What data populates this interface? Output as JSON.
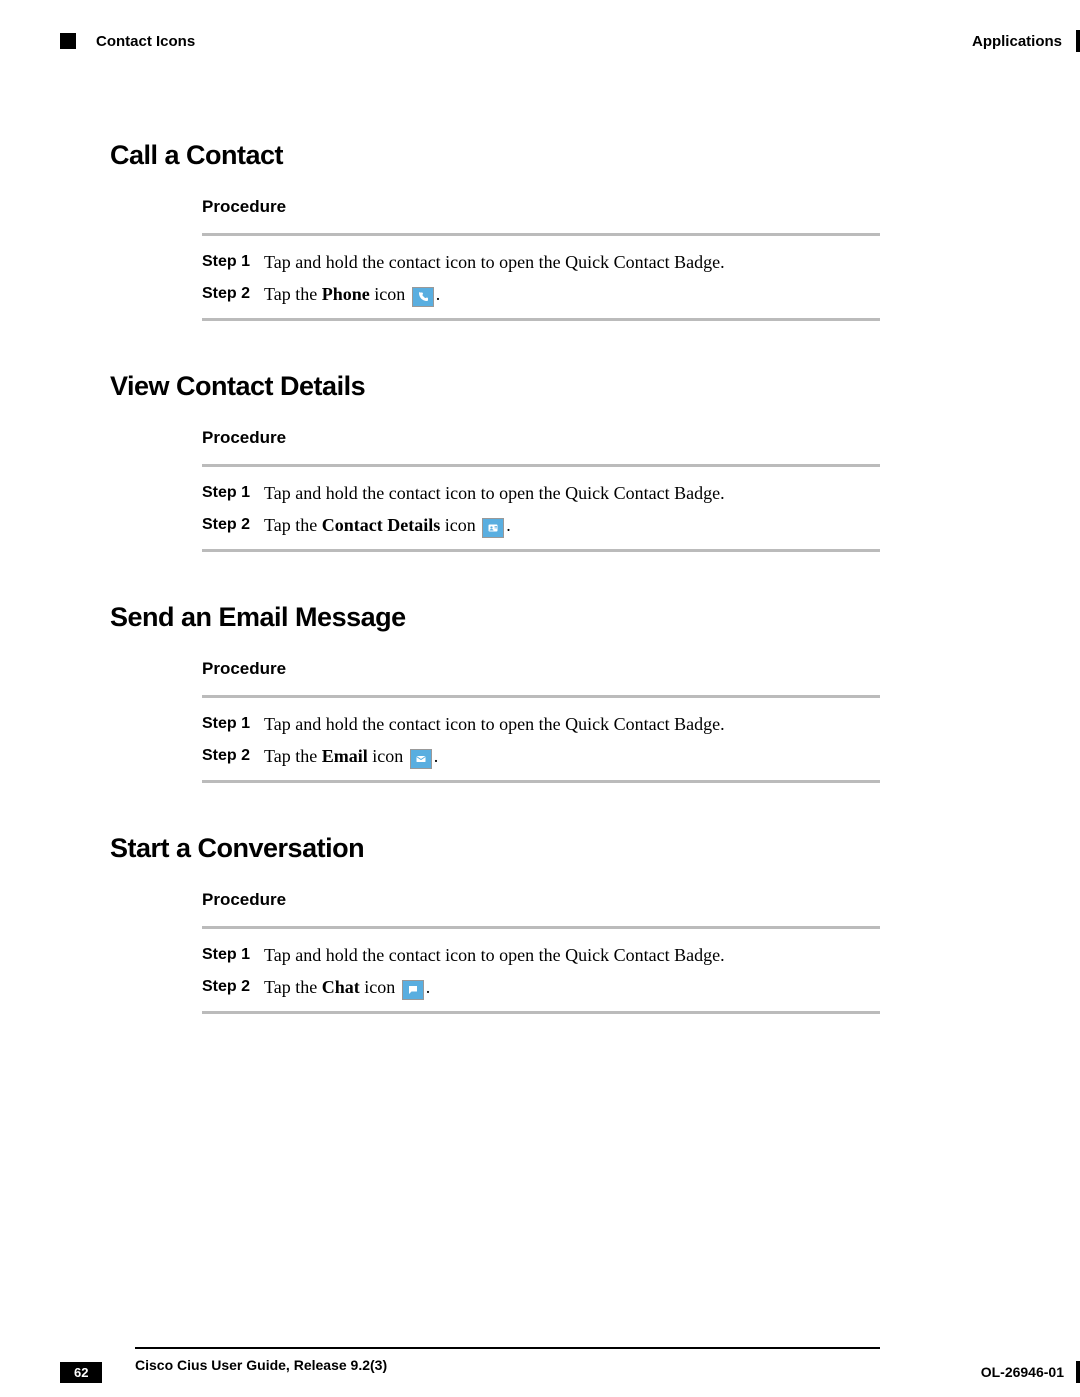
{
  "header": {
    "left": "Contact Icons",
    "right": "Applications"
  },
  "common": {
    "procedure_label": "Procedure",
    "step1_label": "Step 1",
    "step2_label": "Step 2",
    "hold_text": "Tap and hold the contact icon to open the Quick Contact Badge.",
    "tap_the": "Tap the ",
    "icon_word": " icon ",
    "period": "."
  },
  "sections": {
    "call": {
      "title": "Call a Contact",
      "bold": "Phone",
      "icon_name": "phone-icon"
    },
    "view": {
      "title": "View Contact Details",
      "bold": "Contact Details",
      "icon_name": "contact-details-icon"
    },
    "email": {
      "title": "Send an Email Message",
      "bold": "Email",
      "icon_name": "email-icon"
    },
    "chat": {
      "title": "Start a Conversation",
      "bold": "Chat",
      "icon_name": "chat-icon"
    }
  },
  "footer": {
    "title": "Cisco Cius User Guide, Release 9.2(3)",
    "page": "62",
    "docnum": "OL-26946-01"
  }
}
